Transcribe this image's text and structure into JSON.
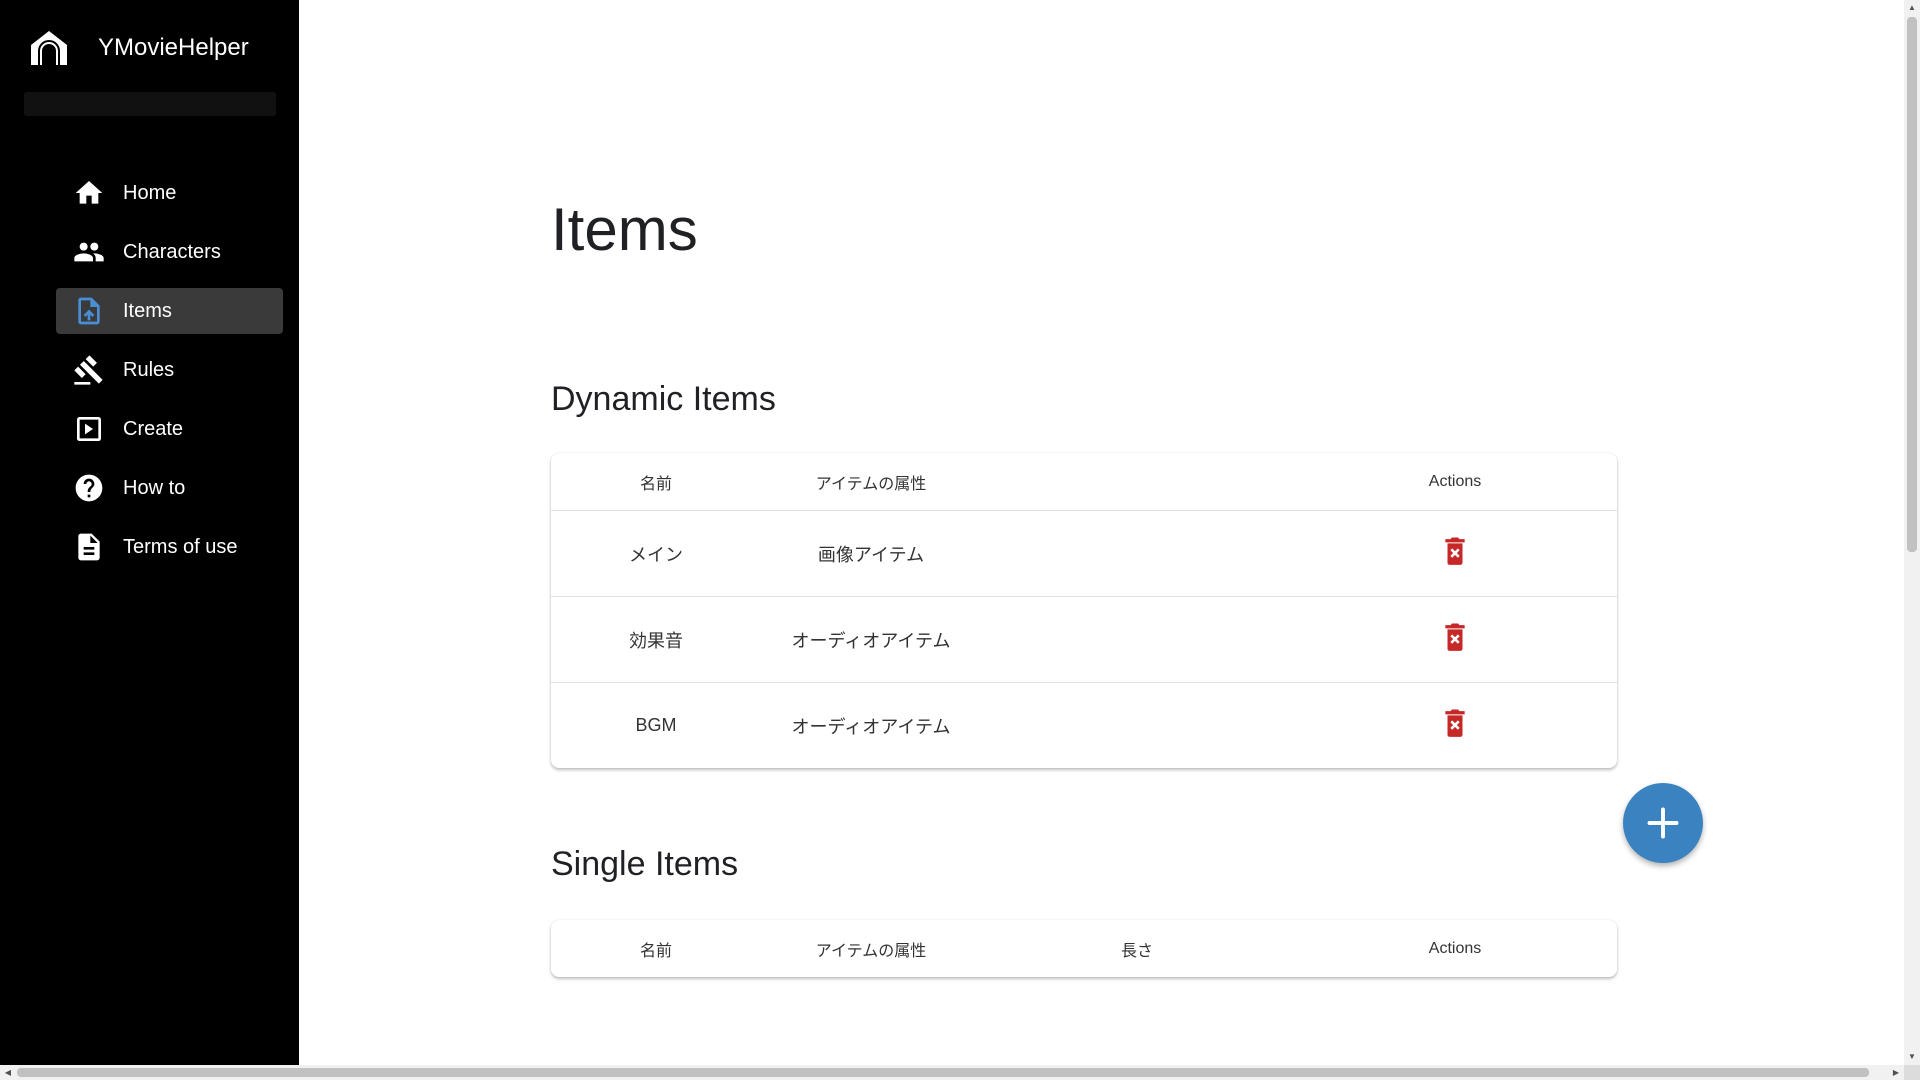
{
  "app": {
    "name": "YMovieHelper",
    "logo_icon": "home-signal-icon"
  },
  "sidebar": {
    "items": [
      {
        "label": "Home",
        "icon": "home-icon",
        "active": false
      },
      {
        "label": "Characters",
        "icon": "people-icon",
        "active": false
      },
      {
        "label": "Items",
        "icon": "file-upload-icon",
        "active": true
      },
      {
        "label": "Rules",
        "icon": "gavel-icon",
        "active": false
      },
      {
        "label": "Create",
        "icon": "play-box-icon",
        "active": false
      },
      {
        "label": "How to",
        "icon": "help-circle-icon",
        "active": false
      },
      {
        "label": "Terms of use",
        "icon": "document-icon",
        "active": false
      }
    ]
  },
  "main": {
    "title": "Items",
    "dynamic_items": {
      "heading": "Dynamic Items",
      "columns": [
        "名前",
        "アイテムの属性",
        "",
        "Actions"
      ],
      "rows": [
        {
          "name": "メイン",
          "type": "画像アイテム",
          "action_icon": "delete-icon"
        },
        {
          "name": "効果音",
          "type": "オーディオアイテム",
          "action_icon": "delete-icon"
        },
        {
          "name": "BGM",
          "type": "オーディオアイテム",
          "action_icon": "delete-icon"
        }
      ]
    },
    "single_items": {
      "heading": "Single Items",
      "columns": [
        "名前",
        "アイテムの属性",
        "長さ",
        "Actions"
      ],
      "rows": []
    },
    "fab_icon": "plus-icon"
  },
  "colors": {
    "sidebar_bg": "#000000",
    "active_item_bg": "#3a3a3a",
    "accent": "#3b83c0",
    "active_icon": "#4a8fd6",
    "delete": "#c62828"
  }
}
